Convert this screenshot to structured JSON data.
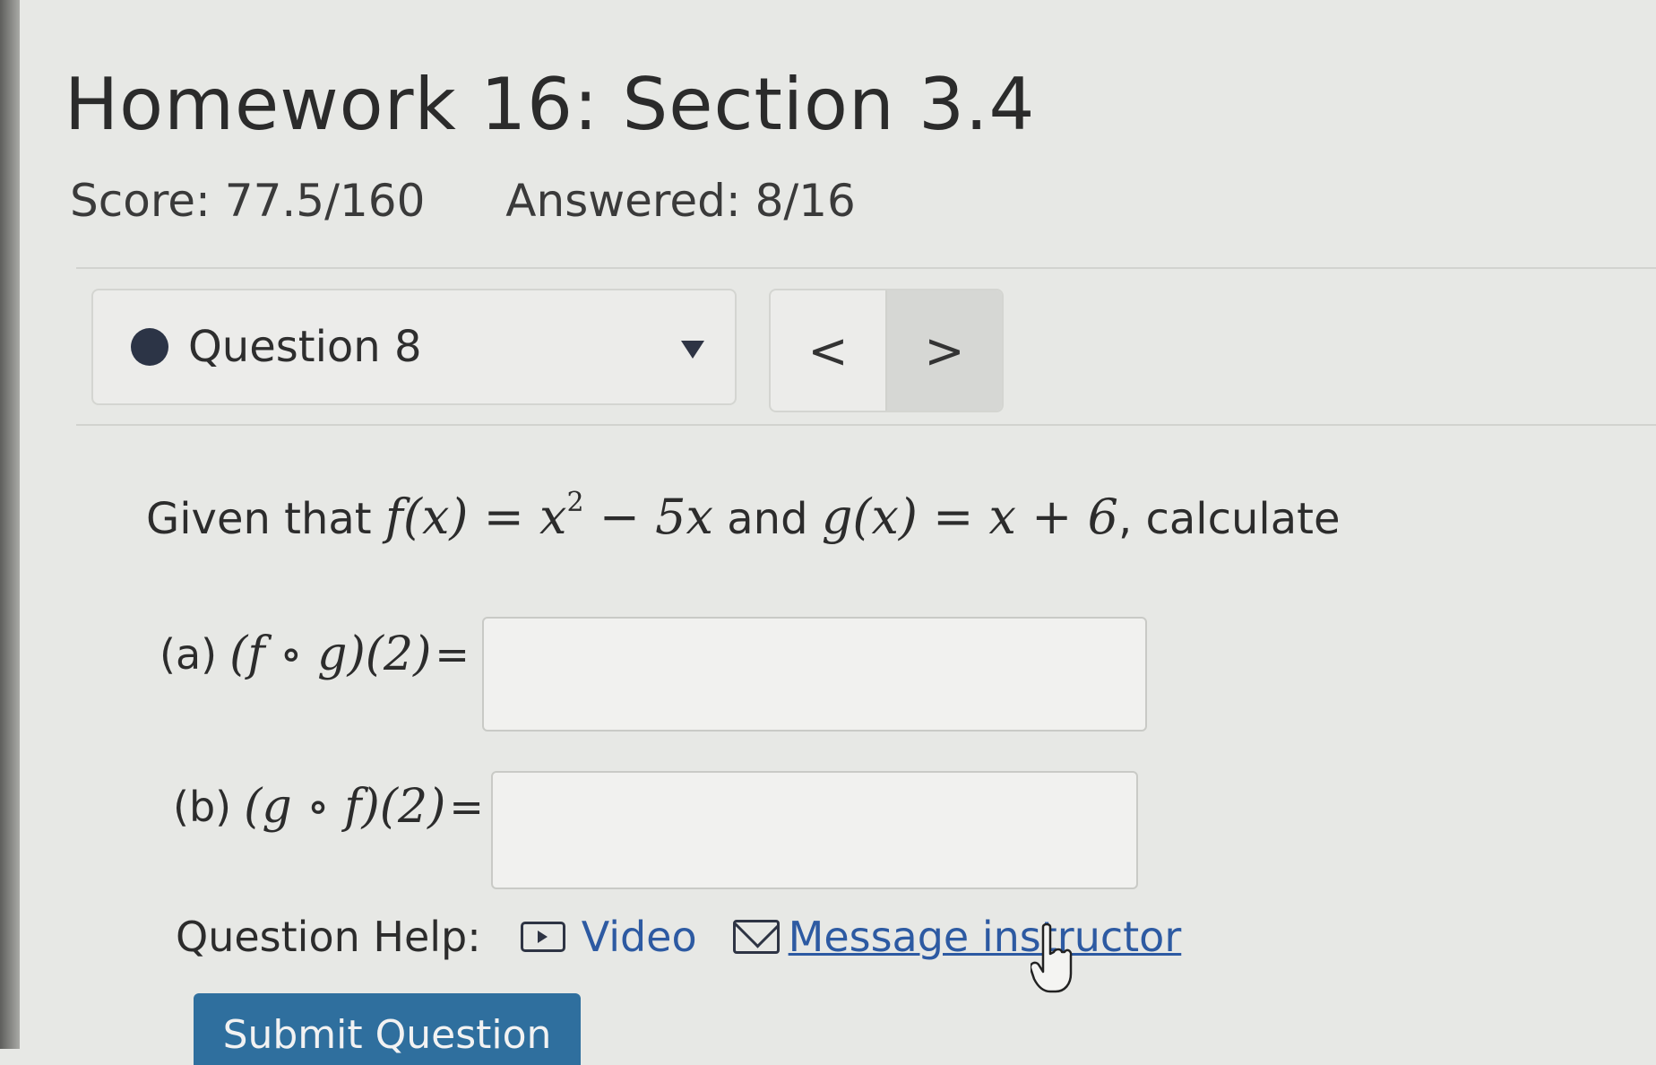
{
  "header": {
    "title": "Homework 16: Section 3.4",
    "score": "Score: 77.5/160",
    "answered": "Answered: 8/16"
  },
  "question_nav": {
    "selected": "Question 8",
    "prev_label": "<",
    "next_label": ">"
  },
  "question": {
    "prompt_start": "Given that",
    "f_def": "f(x) = x",
    "f_exp": "2",
    "f_rest": " − 5x",
    "conjunction": "and",
    "g_def": "g(x) = x + 6",
    "prompt_end": ", calculate",
    "parts": [
      {
        "label": "(a)",
        "expr": "(f ∘ g)(2)",
        "equals": "=",
        "value": ""
      },
      {
        "label": "(b)",
        "expr": "(g ∘ f)(2)",
        "equals": "=",
        "value": ""
      }
    ]
  },
  "help": {
    "label": "Question Help:",
    "video": "Video",
    "message": "Message instructor"
  },
  "submit_label": "Submit Question",
  "colors": {
    "background": "#e7e8e5",
    "link": "#2d5aa2",
    "submit": "#2f6f9e",
    "status_dot": "#2c3446"
  }
}
